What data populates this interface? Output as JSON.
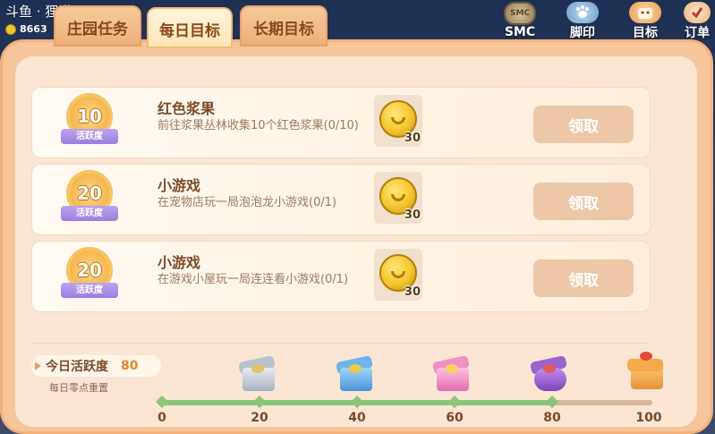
{
  "hud": {
    "name": "斗鱼 · 狸猫",
    "coins": "8663",
    "buttons": [
      {
        "label": "SMC",
        "icon": "smc-badge-icon",
        "badge_text": "SMC"
      },
      {
        "label": "脚印",
        "icon": "footprint-icon"
      },
      {
        "label": "目标",
        "icon": "target-icon"
      },
      {
        "label": "订单",
        "icon": "order-icon"
      }
    ]
  },
  "tabs": [
    {
      "label": "庄园任务",
      "active": false
    },
    {
      "label": "每日目标",
      "active": true
    },
    {
      "label": "长期目标",
      "active": false
    }
  ],
  "tasks": [
    {
      "points": "10",
      "points_label": "活跃度",
      "title": "红色浆果",
      "desc": "前往浆果丛林收集10个红色浆果(0/10)",
      "reward": "30",
      "claim": "领取"
    },
    {
      "points": "20",
      "points_label": "活跃度",
      "title": "小游戏",
      "desc": "在宠物店玩一局泡泡龙小游戏(0/1)",
      "reward": "30",
      "claim": "领取"
    },
    {
      "points": "20",
      "points_label": "活跃度",
      "title": "小游戏",
      "desc": "在游戏小屋玩一局连连看小游戏(0/1)",
      "reward": "30",
      "claim": "领取"
    }
  ],
  "activity": {
    "label": "今日活跃度",
    "value": "80",
    "reset_note": "每日零点重置",
    "progress": 0.8,
    "milestones": [
      "0",
      "20",
      "40",
      "60",
      "80",
      "100"
    ]
  },
  "colors": {
    "accent": "#f3b07a",
    "progress": "#8cc57a",
    "badge_ribbon": "#9a7ee0"
  }
}
